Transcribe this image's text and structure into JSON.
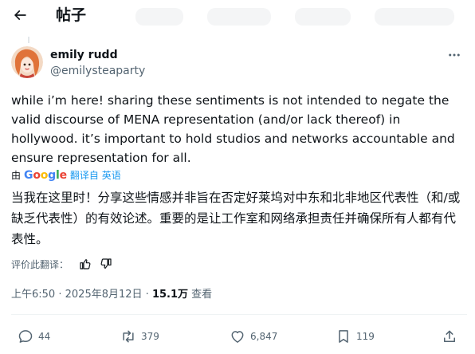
{
  "header": {
    "title": "帖子",
    "back_icon": "arrow-left-icon"
  },
  "author": {
    "display_name": "emily rudd",
    "handle": "@emilysteaparty",
    "avatar_icon": "avatar-illustration"
  },
  "post": {
    "text": "while i’m here! sharing these sentiments is not intended to negate the valid discourse of MENA representation (and/or lack thereof) in hollywood. it’s important to hold studios and networks accountable and ensure representation for all.",
    "translated_by_prefix": "由",
    "translated_by_provider": "Google",
    "translate_link": "翻译自 英语",
    "translated_text": "当我在这里时！分享这些情感并非旨在否定好莱坞对中东和北非地区代表性（和/或缺乏代表性）的有效论述。重要的是让工作室和网络承担责任并确保所有人都有代表性。",
    "rate_label": "评价此翻译："
  },
  "meta": {
    "time": "上午6:50",
    "separator": "·",
    "date": "2025年8月12日",
    "views_count": "15.1万",
    "views_label": "查看"
  },
  "actions": {
    "replies": "44",
    "reposts": "379",
    "likes": "6,847",
    "bookmarks": "119"
  },
  "colors": {
    "accent": "#1d9bf0",
    "secondary_text": "#536471",
    "primary_text": "#0f1419"
  }
}
